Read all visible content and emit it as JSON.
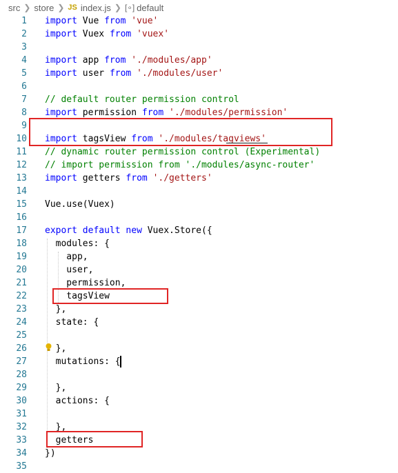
{
  "breadcrumb": {
    "src": "src",
    "store": "store",
    "file_icon": "JS",
    "file": "index.js",
    "symbol_icon": "symbol-icon",
    "symbol": "default"
  },
  "colors": {
    "keyword": "#0000ff",
    "string": "#a31515",
    "comment": "#008000",
    "line_number": "#237893",
    "highlight_box": "#e02424"
  },
  "lines": [
    {
      "n": "1",
      "tokens": [
        {
          "t": "import",
          "c": "kw"
        },
        {
          "t": " Vue ",
          "c": "pr"
        },
        {
          "t": "from",
          "c": "kw"
        },
        {
          "t": " ",
          "c": "pr"
        },
        {
          "t": "'vue'",
          "c": "str"
        }
      ]
    },
    {
      "n": "2",
      "tokens": [
        {
          "t": "import",
          "c": "kw"
        },
        {
          "t": " Vuex ",
          "c": "pr"
        },
        {
          "t": "from",
          "c": "kw"
        },
        {
          "t": " ",
          "c": "pr"
        },
        {
          "t": "'vuex'",
          "c": "str"
        }
      ]
    },
    {
      "n": "3",
      "tokens": []
    },
    {
      "n": "4",
      "tokens": [
        {
          "t": "import",
          "c": "kw"
        },
        {
          "t": " app ",
          "c": "pr"
        },
        {
          "t": "from",
          "c": "kw"
        },
        {
          "t": " ",
          "c": "pr"
        },
        {
          "t": "'./modules/app'",
          "c": "str"
        }
      ]
    },
    {
      "n": "5",
      "tokens": [
        {
          "t": "import",
          "c": "kw"
        },
        {
          "t": " user ",
          "c": "pr"
        },
        {
          "t": "from",
          "c": "kw"
        },
        {
          "t": " ",
          "c": "pr"
        },
        {
          "t": "'./modules/user'",
          "c": "str"
        }
      ]
    },
    {
      "n": "6",
      "tokens": []
    },
    {
      "n": "7",
      "tokens": [
        {
          "t": "// default router permission control",
          "c": "cm"
        }
      ]
    },
    {
      "n": "8",
      "tokens": [
        {
          "t": "import",
          "c": "kw"
        },
        {
          "t": " permission ",
          "c": "pr"
        },
        {
          "t": "from",
          "c": "kw"
        },
        {
          "t": " ",
          "c": "pr"
        },
        {
          "t": "'./modules/permission'",
          "c": "str"
        }
      ]
    },
    {
      "n": "9",
      "tokens": []
    },
    {
      "n": "10",
      "tokens": [
        {
          "t": "import",
          "c": "kw"
        },
        {
          "t": " tagsView ",
          "c": "pr"
        },
        {
          "t": "from",
          "c": "kw"
        },
        {
          "t": " ",
          "c": "pr"
        },
        {
          "t": "'./modules/tagviews'",
          "c": "str"
        }
      ]
    },
    {
      "n": "11",
      "tokens": [
        {
          "t": "// dynamic router permission control (Experimental)",
          "c": "cm"
        }
      ]
    },
    {
      "n": "12",
      "tokens": [
        {
          "t": "// import permission from './modules/async-router'",
          "c": "cm"
        }
      ]
    },
    {
      "n": "13",
      "tokens": [
        {
          "t": "import",
          "c": "kw"
        },
        {
          "t": " getters ",
          "c": "pr"
        },
        {
          "t": "from",
          "c": "kw"
        },
        {
          "t": " ",
          "c": "pr"
        },
        {
          "t": "'./getters'",
          "c": "str"
        }
      ]
    },
    {
      "n": "14",
      "tokens": []
    },
    {
      "n": "15",
      "tokens": [
        {
          "t": "Vue.use(Vuex)",
          "c": "pr"
        }
      ]
    },
    {
      "n": "16",
      "tokens": []
    },
    {
      "n": "17",
      "tokens": [
        {
          "t": "export",
          "c": "kw"
        },
        {
          "t": " ",
          "c": "pr"
        },
        {
          "t": "default",
          "c": "kw"
        },
        {
          "t": " ",
          "c": "pr"
        },
        {
          "t": "new",
          "c": "kw"
        },
        {
          "t": " Vuex.Store({",
          "c": "pr"
        }
      ]
    },
    {
      "n": "18",
      "tokens": [
        {
          "t": "  modules: {",
          "c": "pr"
        }
      ]
    },
    {
      "n": "19",
      "tokens": [
        {
          "t": "    app,",
          "c": "pr"
        }
      ]
    },
    {
      "n": "20",
      "tokens": [
        {
          "t": "    user,",
          "c": "pr"
        }
      ]
    },
    {
      "n": "21",
      "tokens": [
        {
          "t": "    permission,",
          "c": "pr"
        }
      ]
    },
    {
      "n": "22",
      "tokens": [
        {
          "t": "    tagsView",
          "c": "pr"
        }
      ]
    },
    {
      "n": "23",
      "tokens": [
        {
          "t": "  },",
          "c": "pr"
        }
      ]
    },
    {
      "n": "24",
      "tokens": [
        {
          "t": "  state: {",
          "c": "pr"
        }
      ]
    },
    {
      "n": "25",
      "tokens": []
    },
    {
      "n": "26",
      "tokens": [
        {
          "t": "  },",
          "c": "pr"
        }
      ]
    },
    {
      "n": "27",
      "tokens": [
        {
          "t": "  mutations: {",
          "c": "pr"
        }
      ]
    },
    {
      "n": "28",
      "tokens": []
    },
    {
      "n": "29",
      "tokens": [
        {
          "t": "  },",
          "c": "pr"
        }
      ]
    },
    {
      "n": "30",
      "tokens": [
        {
          "t": "  actions: {",
          "c": "pr"
        }
      ]
    },
    {
      "n": "31",
      "tokens": []
    },
    {
      "n": "32",
      "tokens": [
        {
          "t": "  },",
          "c": "pr"
        }
      ]
    },
    {
      "n": "33",
      "tokens": [
        {
          "t": "  getters",
          "c": "pr"
        }
      ]
    },
    {
      "n": "34",
      "tokens": [
        {
          "t": "})",
          "c": "pr"
        }
      ]
    },
    {
      "n": "35",
      "tokens": []
    }
  ]
}
